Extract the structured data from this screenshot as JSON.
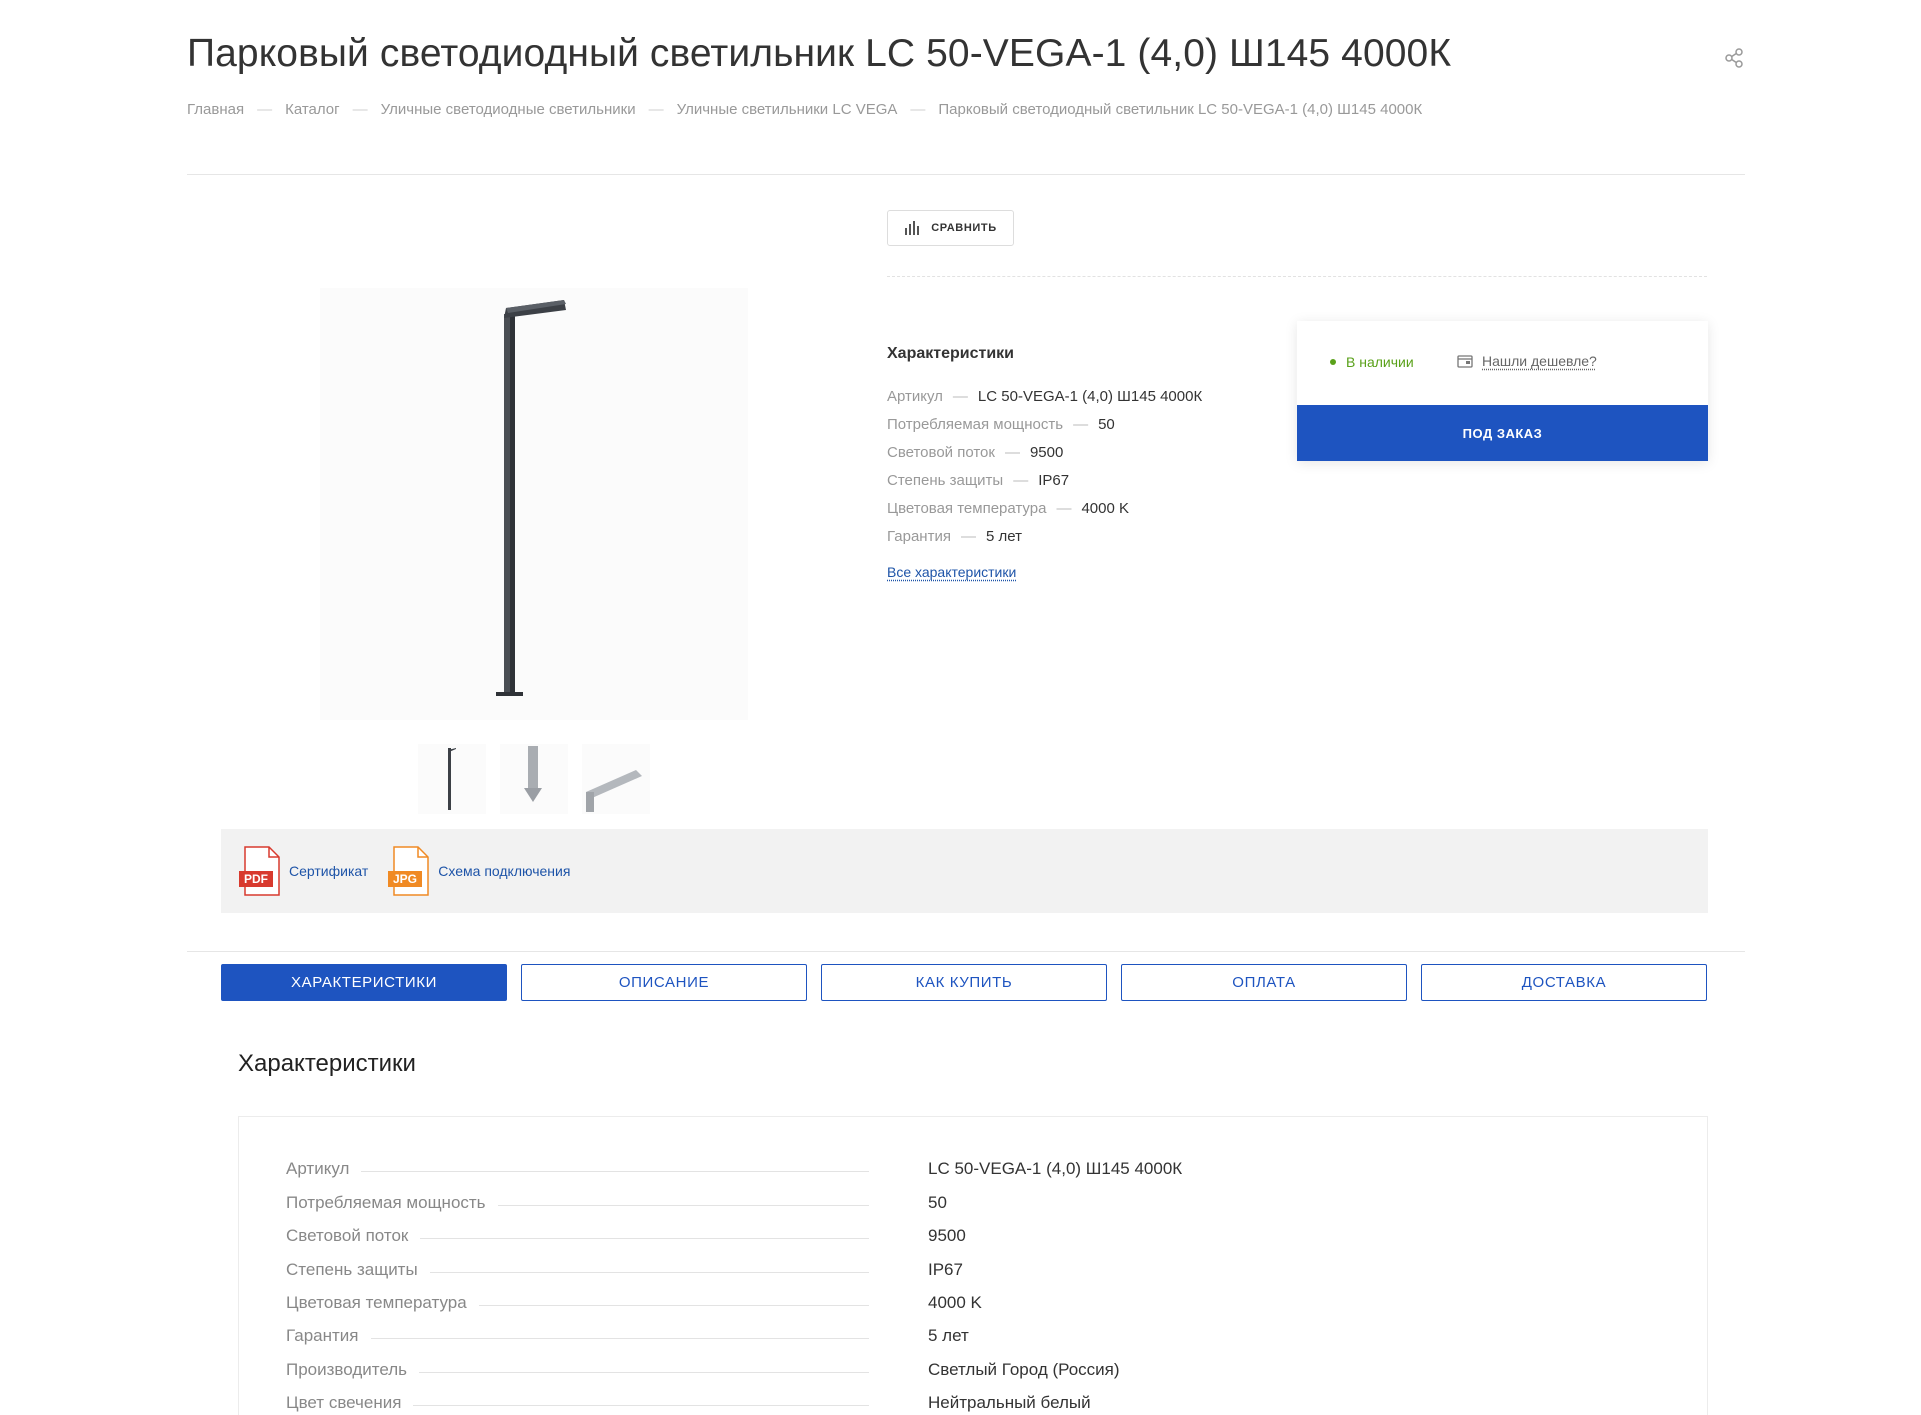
{
  "page": {
    "title": "Парковый светодиодный светильник LC 50-VEGA-1 (4,0) Ш145 4000К"
  },
  "breadcrumb": {
    "items": [
      "Главная",
      "Каталог",
      "Уличные светодиодные светильники",
      "Уличные светильники LC VEGA",
      "Парковый светодиодный светильник LC 50-VEGA-1 (4,0) Ш145 4000К"
    ],
    "separator": "—"
  },
  "compare": {
    "label": "СРАВНИТЬ"
  },
  "summary": {
    "title": "Характеристики",
    "separator": "—",
    "items": [
      {
        "key": "Артикул",
        "value": "LC 50-VEGA-1 (4,0) Ш145 4000К"
      },
      {
        "key": "Потребляемая мощность",
        "value": "50"
      },
      {
        "key": "Световой поток",
        "value": "9500"
      },
      {
        "key": "Степень защиты",
        "value": "IP67"
      },
      {
        "key": "Цветовая температура",
        "value": "4000 K"
      },
      {
        "key": "Гарантия",
        "value": "5 лет"
      }
    ],
    "all_link": "Все характеристики"
  },
  "buy": {
    "stock": "В наличии",
    "cheaper": "Нашли дешевле?",
    "order_button": "ПОД ЗАКАЗ"
  },
  "documents": [
    {
      "badge": "PDF",
      "label": "Сертификат",
      "color": "#d83a2e"
    },
    {
      "badge": "JPG",
      "label": "Схема подключения",
      "color": "#f08a24"
    }
  ],
  "tabs": [
    "ХАРАКТЕРИСТИКИ",
    "ОПИСАНИЕ",
    "КАК КУПИТЬ",
    "ОПЛАТА",
    "ДОСТАВКА"
  ],
  "specs": {
    "title": "Характеристики",
    "rows": [
      {
        "name": "Артикул",
        "value": "LC 50-VEGA-1 (4,0) Ш145 4000К"
      },
      {
        "name": "Потребляемая мощность",
        "value": "50"
      },
      {
        "name": "Световой поток",
        "value": "9500"
      },
      {
        "name": "Степень защиты",
        "value": "IP67"
      },
      {
        "name": "Цветовая температура",
        "value": "4000 K"
      },
      {
        "name": "Гарантия",
        "value": "5 лет"
      },
      {
        "name": "Производитель",
        "value": "Светлый Город (Россия)"
      },
      {
        "name": "Цвет свечения",
        "value": "Нейтральный белый"
      }
    ]
  },
  "colors": {
    "accent": "#1e54c0",
    "link": "#1e54a8",
    "in_stock": "#5aa11a"
  },
  "icons": {
    "share": "share-icon",
    "compare": "bar-chart-icon",
    "cheaper": "wallet-icon"
  }
}
